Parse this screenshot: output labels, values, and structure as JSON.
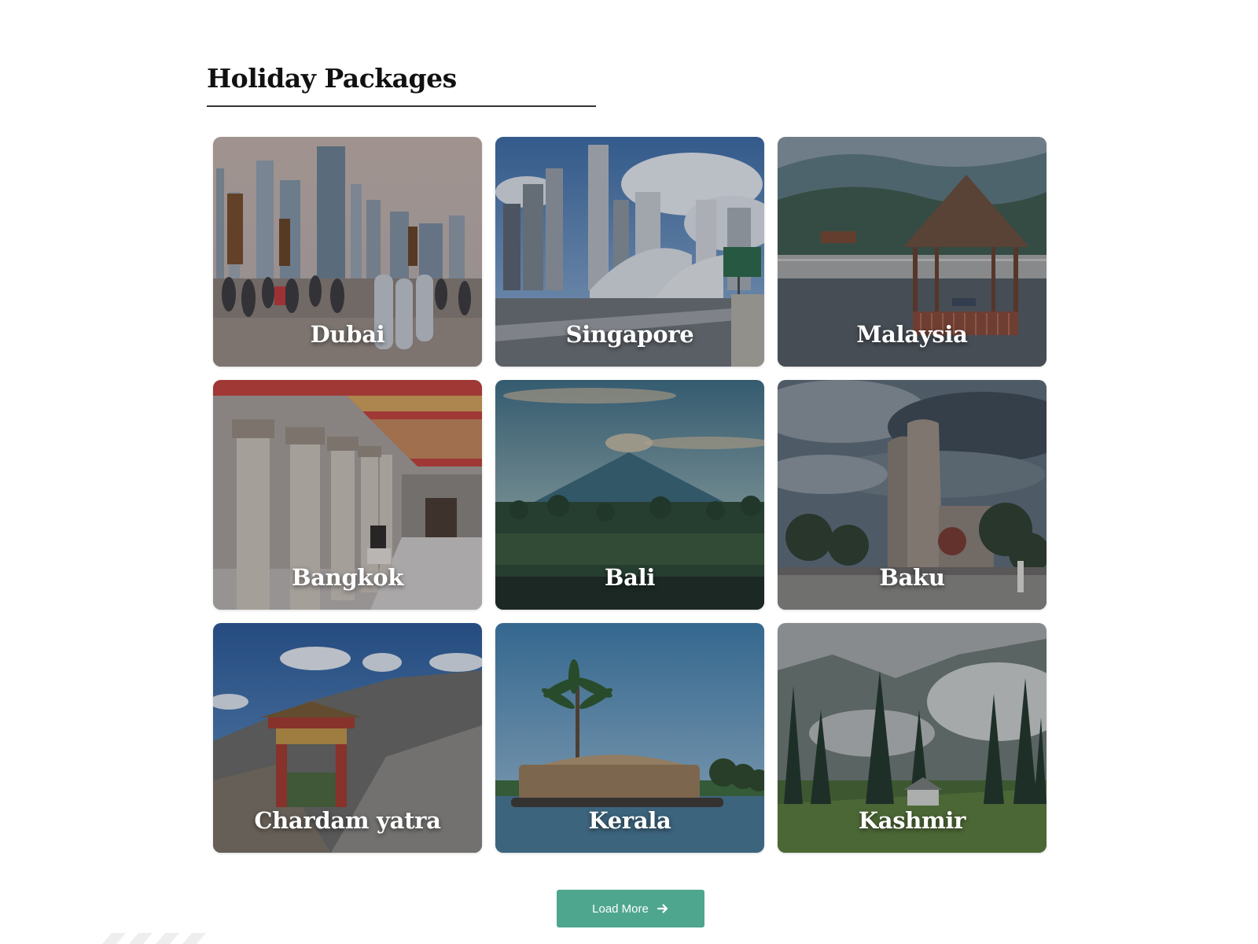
{
  "section": {
    "title": "Holiday Packages"
  },
  "packages": [
    {
      "name": "Dubai",
      "scene": "city-crowd"
    },
    {
      "name": "Singapore",
      "scene": "city-bridge"
    },
    {
      "name": "Malaysia",
      "scene": "pavilion-lake"
    },
    {
      "name": "Bangkok",
      "scene": "temple-columns"
    },
    {
      "name": "Bali",
      "scene": "volcano-forest"
    },
    {
      "name": "Baku",
      "scene": "stone-tower"
    },
    {
      "name": "Chardam yatra",
      "scene": "mountain-gate"
    },
    {
      "name": "Kerala",
      "scene": "houseboat-palm"
    },
    {
      "name": "Kashmir",
      "scene": "pine-valley"
    }
  ],
  "load_more": {
    "label": "Load More",
    "icon": "arrow-right-icon"
  },
  "colors": {
    "accent": "#4ea68e",
    "heading": "#111111",
    "rule": "#333333"
  }
}
